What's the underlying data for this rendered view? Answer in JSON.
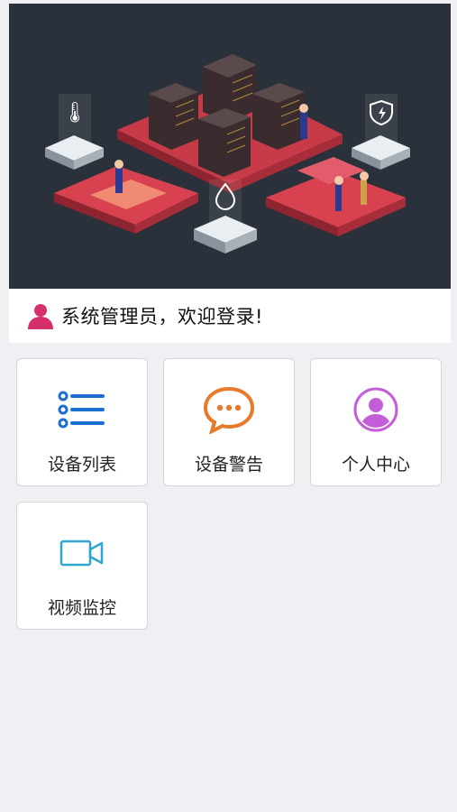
{
  "welcome": {
    "text": "系统管理员，欢迎登录!"
  },
  "menu": {
    "device_list": "设备列表",
    "device_alarm": "设备警告",
    "personal_center": "个人中心",
    "video_monitor": "视频监控"
  },
  "colors": {
    "banner_bg": "#2b313a",
    "platform_red": "#d8414f",
    "list_icon": "#1a6fd0",
    "chat_icon": "#e8792b",
    "user_icon": "#c45ed8",
    "video_icon": "#2fa6cf",
    "avatar": "#d6306c"
  }
}
